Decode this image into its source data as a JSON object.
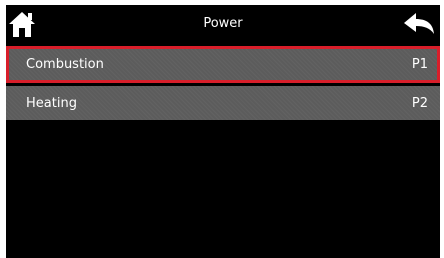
{
  "header": {
    "title": "Power",
    "home_icon": "home-icon",
    "back_icon": "back-arrow-icon"
  },
  "menu": {
    "items": [
      {
        "label": "Combustion",
        "code": "P1",
        "selected": true
      },
      {
        "label": "Heating",
        "code": "P2",
        "selected": false
      }
    ]
  },
  "colors": {
    "background": "#000000",
    "row": "#5c5c5c",
    "selected_border": "#d81e2a",
    "text": "#ffffff"
  }
}
